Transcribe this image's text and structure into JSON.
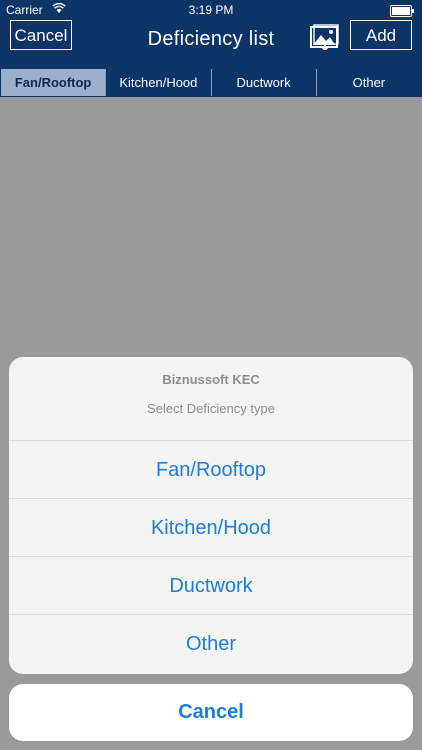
{
  "status_bar": {
    "carrier": "Carrier",
    "time": "3:19 PM"
  },
  "nav": {
    "cancel_label": "Cancel",
    "title": "Deficiency list",
    "add_label": "Add"
  },
  "tabs": [
    {
      "label": "Fan/Rooftop",
      "active": true
    },
    {
      "label": "Kitchen/Hood",
      "active": false
    },
    {
      "label": "Ductwork",
      "active": false
    },
    {
      "label": "Other",
      "active": false
    }
  ],
  "action_sheet": {
    "title": "Biznussoft KEC",
    "message": "Select Deficiency type",
    "options": [
      "Fan/Rooftop",
      "Kitchen/Hood",
      "Ductwork",
      "Other"
    ],
    "cancel_label": "Cancel"
  },
  "colors": {
    "nav_background": "#0c3467",
    "active_tab": "#9bb0cc",
    "action_blue": "#1c7ed6",
    "overlay": "#9a9a9a"
  }
}
